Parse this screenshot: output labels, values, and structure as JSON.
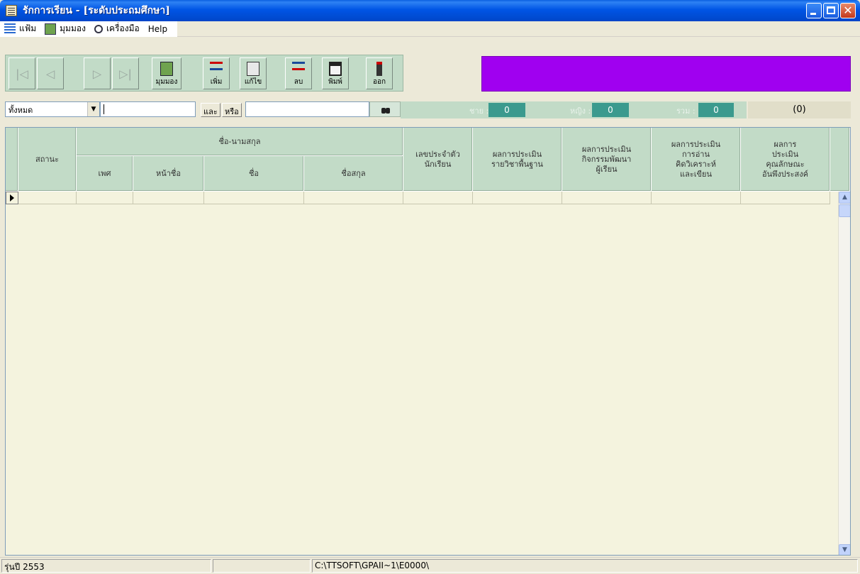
{
  "window": {
    "title": "รักการเรียน - [ระดับประถมศึกษา]"
  },
  "menu": [
    {
      "label": "แฟ้ม",
      "icon": "list-icon"
    },
    {
      "label": "มุมมอง",
      "icon": "view-icon"
    },
    {
      "label": "เครื่องมือ",
      "icon": "tools-icon"
    },
    {
      "label": "Help"
    }
  ],
  "toolbar": {
    "view_label": "มุมมอง",
    "add_label": "เพิ่ม",
    "edit_label": "แก้ไข",
    "delete_label": "ลบ",
    "print_label": "พิมพ์",
    "exit_label": "ออก",
    "accent_color": "#A000F0"
  },
  "filter": {
    "scope_value": "ทั้งหมด",
    "search_value": "",
    "and_label": "และ",
    "or_label": "หรือ",
    "second_value": ""
  },
  "stats": {
    "male_label": "ชาย :",
    "male_value": "0",
    "female_label": "หญิง :",
    "female_value": "0",
    "total_label": "รวม :",
    "total_value": "0",
    "record_count": "(0)"
  },
  "grid": {
    "col_status": "สถานะ",
    "group_name": "ชื่อ-นามสกุล",
    "col_sex": "เพศ",
    "col_prefix": "หน้าชื่อ",
    "col_firstname": "ชื่อ",
    "col_lastname": "ชื่อสกุล",
    "col_student_id": "เลขประจำตัว\nนักเรียน",
    "col_basic_subjects": "ผลการประเมิน\nรายวิชาพื้นฐาน",
    "col_activities": "ผลการประเมิน\nกิจกรรมพัฒนา\nผู้เรียน",
    "col_reading": "ผลการประเมิน\nการอ่าน\nคิดวิเคราะห์\nและเขียน",
    "col_character": "ผลการ\nประเมิน\nคุณลักษณะ\nอันพึงประสงค์"
  },
  "status": {
    "version": "รุ่นปี 2553",
    "path": "C:\\TTSOFT\\GPAII~1\\E0000\\"
  }
}
